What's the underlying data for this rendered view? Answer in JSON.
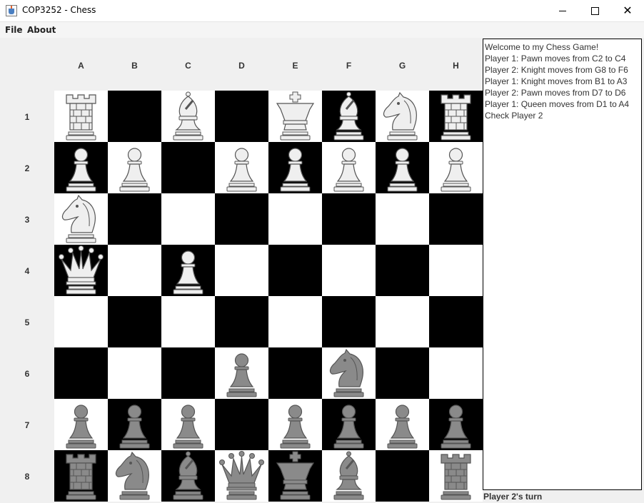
{
  "window": {
    "title": "COP3252 - Chess",
    "minimize": "—",
    "maximize": "☐",
    "close": "✕"
  },
  "menu": {
    "file": "File",
    "about": "About"
  },
  "board": {
    "columns": [
      "A",
      "B",
      "C",
      "D",
      "E",
      "F",
      "G",
      "H"
    ],
    "rows": [
      "1",
      "2",
      "3",
      "4",
      "5",
      "6",
      "7",
      "8"
    ],
    "light_color": "#ffffff",
    "dark_color": "#000000",
    "player1_piece_color": "#efefef",
    "player2_piece_color": "#8a8a8a",
    "pieces": [
      {
        "square": "A1",
        "player": 1,
        "type": "rook"
      },
      {
        "square": "C1",
        "player": 1,
        "type": "bishop"
      },
      {
        "square": "E1",
        "player": 1,
        "type": "king"
      },
      {
        "square": "F1",
        "player": 1,
        "type": "bishop"
      },
      {
        "square": "G1",
        "player": 1,
        "type": "knight"
      },
      {
        "square": "H1",
        "player": 1,
        "type": "rook"
      },
      {
        "square": "A2",
        "player": 1,
        "type": "pawn"
      },
      {
        "square": "B2",
        "player": 1,
        "type": "pawn"
      },
      {
        "square": "D2",
        "player": 1,
        "type": "pawn"
      },
      {
        "square": "E2",
        "player": 1,
        "type": "pawn"
      },
      {
        "square": "F2",
        "player": 1,
        "type": "pawn"
      },
      {
        "square": "G2",
        "player": 1,
        "type": "pawn"
      },
      {
        "square": "H2",
        "player": 1,
        "type": "pawn"
      },
      {
        "square": "A3",
        "player": 1,
        "type": "knight"
      },
      {
        "square": "A4",
        "player": 1,
        "type": "queen"
      },
      {
        "square": "C4",
        "player": 1,
        "type": "pawn"
      },
      {
        "square": "D6",
        "player": 2,
        "type": "pawn"
      },
      {
        "square": "F6",
        "player": 2,
        "type": "knight"
      },
      {
        "square": "A7",
        "player": 2,
        "type": "pawn"
      },
      {
        "square": "B7",
        "player": 2,
        "type": "pawn"
      },
      {
        "square": "C7",
        "player": 2,
        "type": "pawn"
      },
      {
        "square": "E7",
        "player": 2,
        "type": "pawn"
      },
      {
        "square": "F7",
        "player": 2,
        "type": "pawn"
      },
      {
        "square": "G7",
        "player": 2,
        "type": "pawn"
      },
      {
        "square": "H7",
        "player": 2,
        "type": "pawn"
      },
      {
        "square": "A8",
        "player": 2,
        "type": "rook"
      },
      {
        "square": "B8",
        "player": 2,
        "type": "knight"
      },
      {
        "square": "C8",
        "player": 2,
        "type": "bishop"
      },
      {
        "square": "D8",
        "player": 2,
        "type": "queen"
      },
      {
        "square": "E8",
        "player": 2,
        "type": "king"
      },
      {
        "square": "F8",
        "player": 2,
        "type": "bishop"
      },
      {
        "square": "H8",
        "player": 2,
        "type": "rook"
      }
    ]
  },
  "log": {
    "lines": [
      "Welcome to my Chess Game!",
      "Player 1: Pawn moves from C2 to C4",
      "Player 2: Knight moves from G8 to F6",
      "Player 1: Knight moves from B1 to A3",
      "Player 2: Pawn moves from D7 to D6",
      "Player 1: Queen moves from D1 to A4",
      "Check Player 2"
    ]
  },
  "status": {
    "text": "Player 2's turn"
  }
}
